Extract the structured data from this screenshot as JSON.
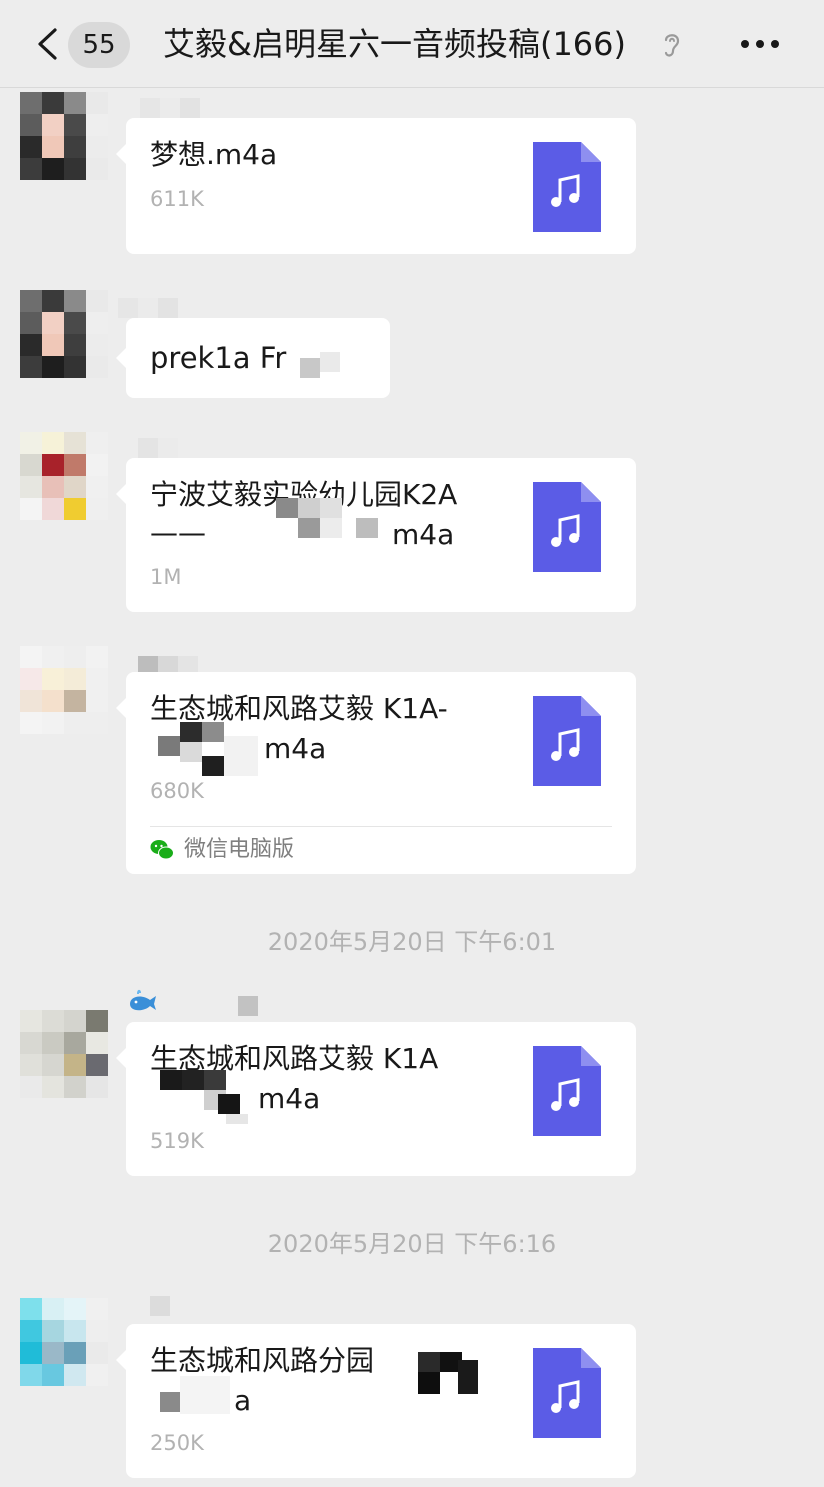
{
  "header": {
    "unread_count": "55",
    "title": "艾毅&启明星六一音频投稿(166)"
  },
  "timestamps": [
    "2020年5月20日 下午6:01",
    "2020年5月20日 下午6:16"
  ],
  "messages": [
    {
      "type": "file",
      "file_name": "梦想.m4a",
      "file_size": "611K"
    },
    {
      "type": "text",
      "text": "prek1a Fr"
    },
    {
      "type": "file",
      "file_name": "宁波艾毅实验幼儿园K2A——",
      "file_name_tail": "m4a",
      "file_size": "1M"
    },
    {
      "type": "file",
      "file_name": "生态城和风路艾毅 K1A-",
      "file_name_tail": "m4a",
      "file_size": "680K",
      "source": "微信电脑版"
    },
    {
      "type": "file",
      "file_name": "生态城和风路艾毅 K1A",
      "file_name_tail": "m4a",
      "file_size": "519K"
    },
    {
      "type": "file",
      "file_name": "生态城和风路分园",
      "file_name_tail": "a",
      "file_size": "250K"
    }
  ],
  "colors": {
    "background": "#ededed",
    "bubble": "#ffffff",
    "file_icon": "#5b5ce6",
    "muted_text": "#b2b2b2",
    "wechat_green": "#1aad19"
  },
  "icons": {
    "back": "chevron-left-icon",
    "ear": "ear-icon",
    "more": "more-dots-icon",
    "file": "music-file-icon",
    "source": "wechat-logo-icon"
  }
}
